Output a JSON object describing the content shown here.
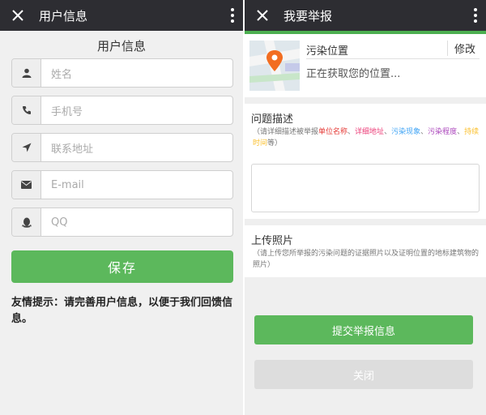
{
  "left": {
    "header_title": "用户信息",
    "form_title": "用户信息",
    "fields": [
      {
        "icon": "user-icon",
        "placeholder": "姓名"
      },
      {
        "icon": "phone-icon",
        "placeholder": "手机号"
      },
      {
        "icon": "location-arrow-icon",
        "placeholder": "联系地址"
      },
      {
        "icon": "envelope-icon",
        "placeholder": "E-mail"
      },
      {
        "icon": "qq-icon",
        "placeholder": "QQ"
      }
    ],
    "save_label": "保存",
    "tip": "友情提示：请完善用户信息，以便于我们回馈信息。"
  },
  "right": {
    "header_title": "我要举报",
    "location_title": "污染位置",
    "edit_label": "修改",
    "location_status": "正在获取您的位置...",
    "problem_title": "问题描述",
    "problem_hint": {
      "prefix": "（请详细描述被举报",
      "red": "单位名称",
      "sep1": "、",
      "pink": "详细地址",
      "sep2": "、",
      "blue": "污染现象",
      "sep3": "、",
      "purple": "污染程度",
      "sep4": "、",
      "yellow": "持续时间",
      "suffix": "等）"
    },
    "photo_title": "上传照片",
    "photo_hint": "（请上传您所举报的污染问题的证据照片以及证明位置的地标建筑物的照片）",
    "submit_label": "提交举报信息",
    "close_label": "关闭"
  },
  "colors": {
    "header_bg": "#2d2d32",
    "accent_green": "#5cb85c",
    "map_pin": "#f26d21"
  }
}
